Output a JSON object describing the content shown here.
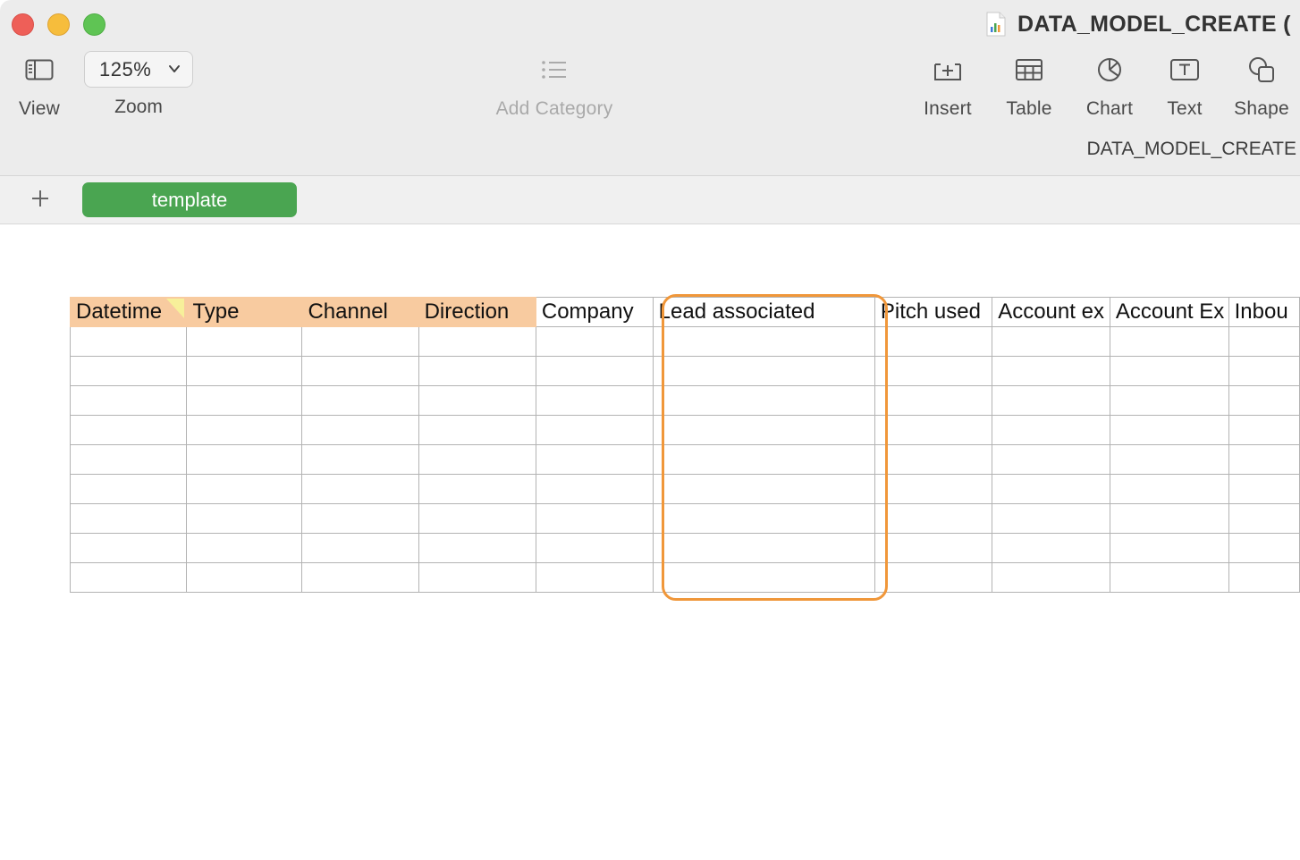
{
  "window": {
    "title": "DATA_MODEL_CREATE ("
  },
  "toolbar": {
    "view_label": "View",
    "zoom_value": "125%",
    "zoom_label": "Zoom",
    "add_category_label": "Add Category",
    "insert_label": "Insert",
    "table_label": "Table",
    "chart_label": "Chart",
    "text_label": "Text",
    "shape_label": "Shape",
    "sheet_name": "DATA_MODEL_CREATE"
  },
  "tabs": {
    "items": [
      {
        "label": "template",
        "active": true
      }
    ]
  },
  "table": {
    "columns": [
      {
        "label": "Datetime",
        "highlighted": true
      },
      {
        "label": "Type",
        "highlighted": true
      },
      {
        "label": "Channel",
        "highlighted": true
      },
      {
        "label": "Direction",
        "highlighted": true
      },
      {
        "label": "Company",
        "highlighted": false
      },
      {
        "label": "Lead associated",
        "highlighted": false
      },
      {
        "label": "Pitch used",
        "highlighted": false
      },
      {
        "label": "Account ex",
        "highlighted": false
      },
      {
        "label": "Account Ex",
        "highlighted": false
      },
      {
        "label": "Inbou",
        "highlighted": false
      }
    ],
    "empty_row_count": 9,
    "highlighted_column": "Lead associated"
  },
  "colors": {
    "header_highlight": "#f8cba0",
    "tab_active": "#4aa551",
    "selection_outline": "#f0973a"
  }
}
